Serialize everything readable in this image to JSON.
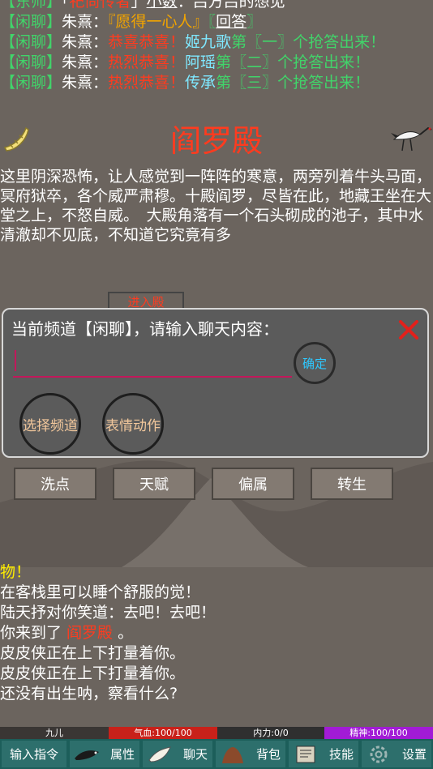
{
  "chat": {
    "row0": {
      "a": "【东师】",
      "b": "「",
      "c": "祀尚传者",
      "d": "」",
      "e": "小数",
      "f": "：吕方吕的想见"
    },
    "row1": {
      "tag": "【闲聊】",
      "name": "朱熹：",
      "q": "『愿得一心人』",
      "open": "〖",
      "ans": "回答",
      "close": "〗"
    },
    "winners": [
      {
        "tag": "【闲聊】",
        "name": "朱熹：",
        "cheer": "恭喜恭喜！",
        "who": "姬九歌",
        "pre": "第",
        "num": "〖一〗",
        "post": "个抢答出来！"
      },
      {
        "tag": "【闲聊】",
        "name": "朱熹：",
        "cheer": "热烈恭喜！",
        "who": "阿瑶",
        "pre": "第",
        "num": "〖二〗",
        "post": "个抢答出来！"
      },
      {
        "tag": "【闲聊】",
        "name": "朱熹：",
        "cheer": "热烈恭喜！",
        "who": "传承",
        "pre": "第",
        "num": "〖三〗",
        "post": "个抢答出来！"
      }
    ]
  },
  "room": {
    "title": "阎罗殿",
    "description": "这里阴深恐怖，让人感觉到一阵阵的寒意，两旁列着牛头马面，冥府狱卒，各个威严肃穆。十殿阎罗，尽皆在此，地藏王坐在大堂之上，不怒自威。　大殿角落有一个石头砌成的池子，其中水清澈却不见底，不知道它究竟有多",
    "hidden_button": "进入殿"
  },
  "dialog": {
    "title": "当前频道【闲聊】，请输入聊天内容：",
    "input_value": "",
    "confirm": "确定",
    "select_channel": "选择频道",
    "emote": "表情动作"
  },
  "actions": [
    "洗点",
    "天赋",
    "偏属",
    "转生"
  ],
  "log": {
    "l1": "物！",
    "l2": "在客栈里可以睡个舒服的觉！",
    "l3": "陆天抒对你笑道：去吧！去吧！",
    "l4_pre": "你来到了 ",
    "l4_place": "阎罗殿",
    "l4_post": " 。",
    "l5": "皮皮侠正在上下打量着你。",
    "l6": "皮皮侠正在上下打量着你。",
    "l7": "还没有出生呐，察看什么?"
  },
  "status": {
    "name": "九儿",
    "hp": "气血:100/100",
    "mp": "内力:0/0",
    "spirit": "精神:100/100"
  },
  "toolbar": [
    "输入指令",
    "属性",
    "聊天",
    "背包",
    "技能",
    "设置"
  ],
  "colors": {
    "hp": "#c8211a",
    "spirit": "#a21bd6",
    "accent_red": "#ff3b1f",
    "chat_green": "#41d46a"
  }
}
